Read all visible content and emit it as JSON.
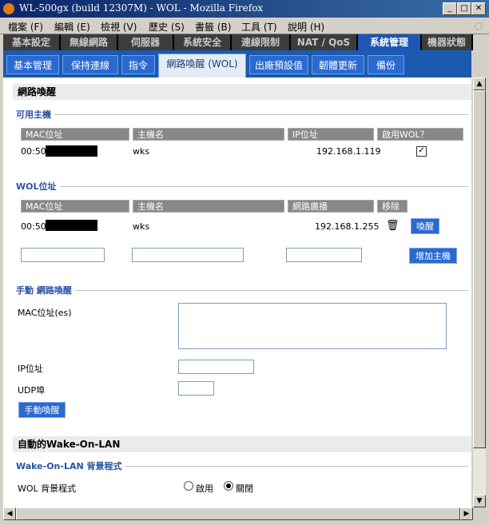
{
  "window": {
    "title": "WL-500gx (build 12307M) - WOL - Mozilla Firefox"
  },
  "menu": [
    "檔案 (F)",
    "編輯 (E)",
    "檢視 (V)",
    "歷史 (S)",
    "書籤 (B)",
    "工具 (T)",
    "說明 (H)"
  ],
  "main_tabs": [
    "基本設定",
    "無線網路",
    "伺服器",
    "系統安全",
    "連線限制",
    "NAT / QoS",
    "系統管理",
    "機器狀態"
  ],
  "main_tab_active": "系統管理",
  "sub_tabs": [
    "基本管理",
    "保持連線",
    "指令",
    "網路喚醒 (WOL)",
    "出廠預設值",
    "韌體更新",
    "備份"
  ],
  "sub_tab_active": "網路喚醒 (WOL)",
  "section_wol": "網路喚醒",
  "available_hosts": {
    "title": "可用主機",
    "headers": [
      "MAC位址",
      "主機名",
      "IP位址",
      "啟用WOL？"
    ],
    "rows": [
      {
        "mac": "00:50:",
        "host": "wks",
        "ip": "192.168.1.119",
        "enabled": true
      }
    ]
  },
  "wol_addresses": {
    "title": "WOL位址",
    "headers": [
      "MAC位址",
      "主機名",
      "網路廣播",
      "移除"
    ],
    "rows": [
      {
        "mac": "00:50:",
        "host": "wks",
        "broadcast": "192.168.1.255"
      }
    ],
    "wake_label": "喚醒",
    "add_label": "增加主機"
  },
  "manual_wake": {
    "title": "手動 網路喚醒",
    "mac_label": "MAC位址(es)",
    "ip_label": "IP位址",
    "udp_label": "UDP埠",
    "button": "手動喚醒"
  },
  "auto_wol": {
    "section": "自動的Wake-On-LAN",
    "title": "Wake-On-LAN 背景程式",
    "daemon_label": "WOL 背景程式",
    "enable_label": "啟用",
    "disable_label": "關閉",
    "selected": "關閉"
  },
  "colors": {
    "accent": "#1c5ab0",
    "group_title": "#2a52a0",
    "tab_dark": "#3c3c3c"
  }
}
